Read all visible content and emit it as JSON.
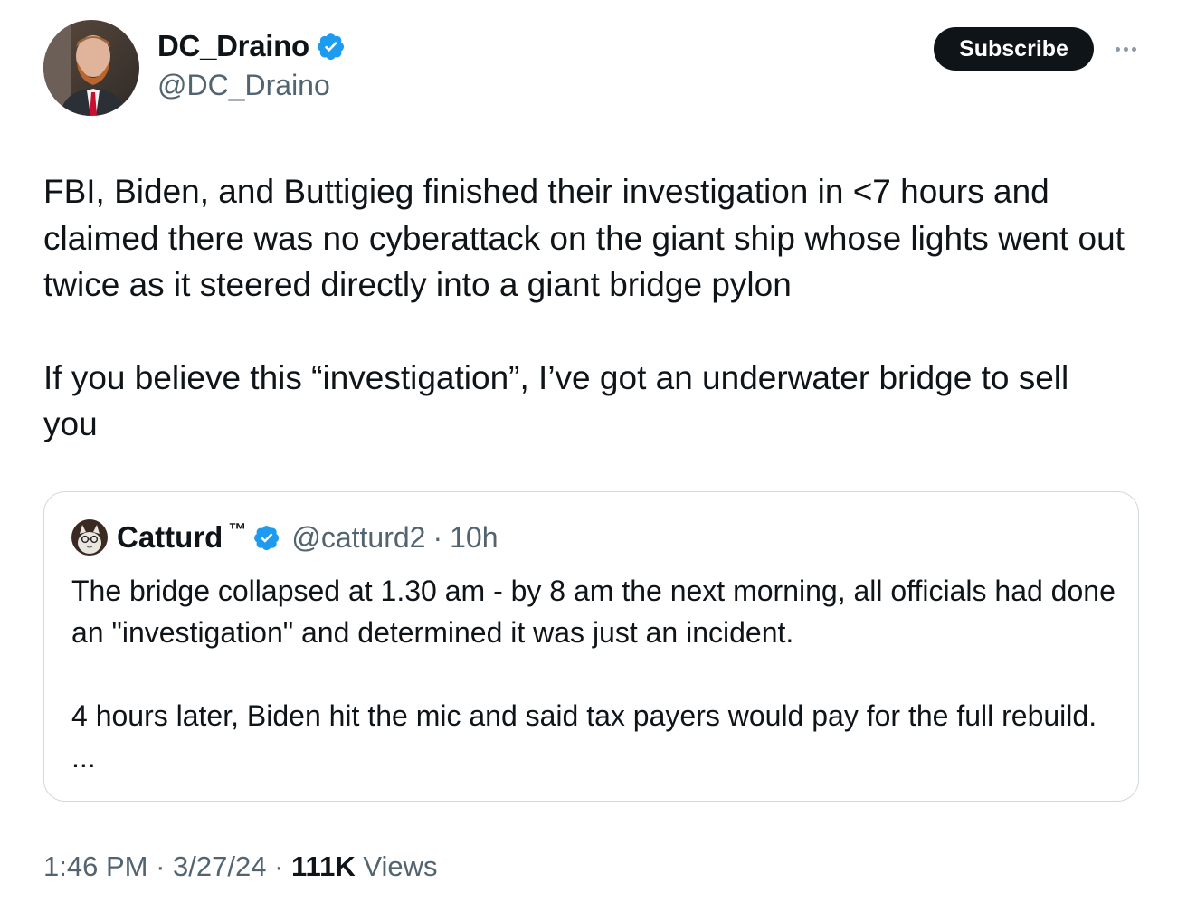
{
  "author": {
    "name": "DC_Draino",
    "handle": "@DC_Draino"
  },
  "actions": {
    "subscribe_label": "Subscribe"
  },
  "tweet": {
    "paragraphs": [
      "FBI, Biden, and Buttigieg finished their investigation in <7 hours and claimed there was no cyberattack on the giant ship whose lights went out twice as it steered directly into a giant bridge pylon",
      "If you believe this “investigation”, I’ve got an underwater bridge to sell you"
    ]
  },
  "quote": {
    "name": "Catturd",
    "tm": "™",
    "handle": "@catturd2",
    "separator": "·",
    "time": "10h",
    "paragraphs": [
      "The bridge collapsed at 1.30 am - by  8 am the next morning, all officials had done an \"investigation\" and determined it was just an incident.",
      "4 hours later, Biden hit the mic and said tax payers would pay for the full rebuild. ..."
    ]
  },
  "meta": {
    "time": "1:46 PM",
    "sep1": " · ",
    "date": "3/27/24",
    "sep2": " · ",
    "views_count": "111K",
    "views_label": " Views"
  },
  "colors": {
    "text": "#0f1419",
    "secondary": "#536471",
    "verified": "#1d9bf0",
    "border": "#cfd9de",
    "button_bg": "#0f1419"
  },
  "icons": {
    "verified": "verified-badge-icon",
    "more": "more-dots-icon"
  }
}
